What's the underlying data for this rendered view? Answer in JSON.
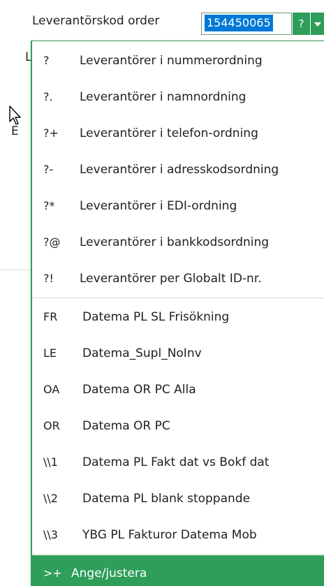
{
  "header": {
    "field_label": "Leverantörskod order",
    "code_value": "154450065",
    "query_button_label": "?"
  },
  "background": {
    "frag_l": "L",
    "frag_e": "E"
  },
  "menu": {
    "groups": [
      {
        "items": [
          {
            "code": "?",
            "label": "Leverantörer i nummerordning"
          },
          {
            "code": "?.",
            "label": "Leverantörer i namnordning"
          },
          {
            "code": "?+",
            "label": "Leverantörer i telefon-ordning"
          },
          {
            "code": "?-",
            "label": "Leverantörer i adresskodsordning"
          },
          {
            "code": "?*",
            "label": "Leverantörer i EDI-ordning"
          },
          {
            "code": "?@",
            "label": "Leverantörer i bankkodsordning"
          },
          {
            "code": "?!",
            "label": "Leverantörer per Globalt ID-nr."
          }
        ]
      },
      {
        "items": [
          {
            "code": "FR",
            "label": "Datema PL SL Frisökning"
          },
          {
            "code": "LE",
            "label": "Datema_Supl_NoInv"
          },
          {
            "code": "OA",
            "label": "Datema OR PC Alla"
          },
          {
            "code": "OR",
            "label": "Datema OR PC"
          },
          {
            "code": "\\\\1",
            "label": "Datema PL Fakt dat vs Bokf dat"
          },
          {
            "code": "\\\\2",
            "label": "Datema PL blank stoppande"
          },
          {
            "code": "\\\\3",
            "label": "YBG PL Fakturor Datema Mob"
          }
        ]
      }
    ],
    "active_item": {
      "code": ">+",
      "label": "Ange/justera"
    }
  },
  "colors": {
    "accent_green": "#2e9e5a",
    "selection_blue": "#0078d7"
  },
  "icons": {
    "cursor": "mouse-pointer-icon",
    "dropdown": "chevron-down-icon"
  }
}
